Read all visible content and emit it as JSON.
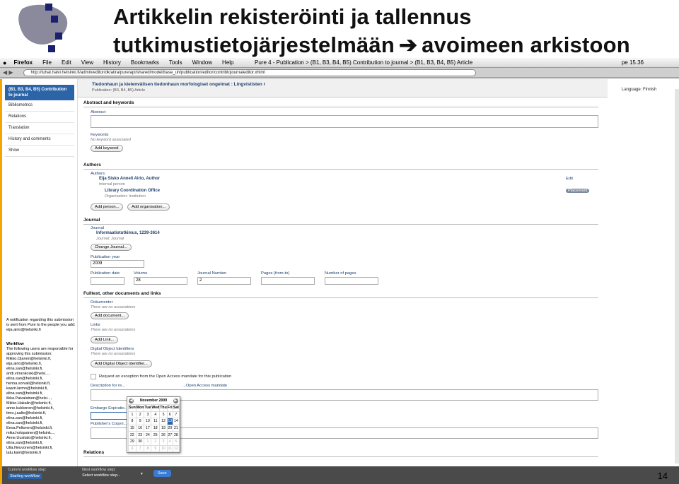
{
  "slide": {
    "title_line1": "Artikkelin rekisteröinti ja tallennus",
    "title_line2a": "tutkimustietojärjestelmään",
    "arrow": "➔",
    "title_line2b": "avoimeen arkistoon",
    "page_number": "14"
  },
  "menubar": {
    "apple": "",
    "items": [
      "Firefox",
      "File",
      "Edit",
      "View",
      "History",
      "Bookmarks",
      "Tools",
      "Window",
      "Help"
    ],
    "window_title": "Pure 4 - Publication > (B1, B3, B4, B5) Contribution to journal > (B1, B3, B4, B5) Article",
    "clock": "pe 15.36"
  },
  "toolbar": {
    "url": "http://tuhat.halvi.helsinki.fi/admin/editor/dk/atira/pure/api/shared/model/base_uh/publication/editor/contribtojournaleditor.xhtml"
  },
  "header": {
    "title": "Tiedonhaun ja kielenvälisen tiedonhaun morfologiset ongelmat : Lingvististen r",
    "subtitle": "Publication: (B3, B4, B5) Article"
  },
  "language": {
    "label": "Language:",
    "value": "Finnish"
  },
  "sidebar": {
    "active": "(B1, B3, B4, B5) Contribution to journal",
    "items": [
      "Bibliometrics",
      "Relations",
      "Translation",
      "History and comments",
      "Show"
    ],
    "notification": "A notification regarding this submission is sent from Pure to the people you add: eija.airio@helsinki.fi",
    "workflow_title": "Workflow",
    "workflow_text": "The following users are responsible for approving this submission: Mikko.Ojanen@helsinki.fi, eija.airio@helsinki.fi, elina.san@helsinki.fi, antti.virrankoski@helsi..., elina.san@helsinki.fi, henna.sorvali@helsinki.fi, kaarri.larmo@helsinki.fi, elina.san@helsinki.fi, ilkka.Paivalainen@helsi..., Mikko.Hakalin@helsinki.fi, anne.kukkonen@helsinki.fi, timo.j.aalto@helsinki.fi, elina.san@helsinki.fi, elina.san@helsinki.fi, Eeva.Peltonen@helsinki.fi, mika.holopainen@helsink..., Anne.Uusitalo@helsinki.fi, elina.san@helsinki.fi, Ulla.Neuvonen@helsinki.fi, tatu.kairi@helsinki.fi"
  },
  "sections": {
    "abstract": "Abstract and keywords",
    "abstract_label": "Abstract",
    "keywords_label": "Keywords",
    "no_keyword": "No keyword associated",
    "add_keyword": "Add keyword",
    "authors": "Authors",
    "authors_label": "Authors",
    "author_name": "Eija Sisko Anneli Airio, Author",
    "author_type": "Internal person",
    "org_name": "Library Coordination Office",
    "org_type": "Organisation: Institution",
    "edit": "Edit",
    "placement": "Placement",
    "add_person": "Add person...",
    "add_org": "Add organisation...",
    "journal": "Journal",
    "journal_label": "Journal",
    "journal_name": "Informaatiotutkimus, 1239-3614",
    "journal_type": "Journal: Journal",
    "change_journal": "Change Journal...",
    "pubyear_label": "Publication year",
    "pubyear": "2009",
    "pubdate_label": "Publication date",
    "volume_label": "Volume",
    "volume": "28",
    "journalnum_label": "Journal Number",
    "journalnum": "2",
    "pages_label": "Pages (from-to)",
    "numpages_label": "Number of pages",
    "fulltext": "Fulltext, other documents and links",
    "documents_label": "Dokumenter",
    "no_assoc": "There are no associations",
    "add_document": "Add document...",
    "links_label": "Links",
    "add_link": "Add Link...",
    "doi_label": "Digital Object Identifiers",
    "add_doi": "Add Digital Object Identifier...",
    "oa_request": "Request an exception from the Open Access mandate for this publication",
    "desc_label": "Description for re...",
    "desc_suffix": "...Open Access mandate",
    "embargo_label": "Embargo Expiratio...",
    "copyright_label": "Publisher's Copyri...",
    "relations": "Relations"
  },
  "calendar": {
    "month": "November 2009",
    "days": [
      "Sun",
      "Mon",
      "Tue",
      "Wed",
      "Thu",
      "Fri",
      "Sat"
    ],
    "weeks": [
      [
        "1",
        "2",
        "3",
        "4",
        "5",
        "6",
        "7"
      ],
      [
        "8",
        "9",
        "10",
        "11",
        "12",
        "13",
        "14"
      ],
      [
        "15",
        "16",
        "17",
        "18",
        "19",
        "20",
        "21"
      ],
      [
        "22",
        "23",
        "24",
        "25",
        "26",
        "27",
        "28"
      ],
      [
        "29",
        "30",
        "1",
        "2",
        "3",
        "4",
        "5"
      ],
      [
        "6",
        "7",
        "8",
        "9",
        "10",
        "11",
        "12"
      ]
    ],
    "selected": "13"
  },
  "footer": {
    "current_label": "Current workflow step:",
    "current": "Starting workflow",
    "next_label": "Next workflow step:",
    "next": "Select workflow step...",
    "save": "Save"
  }
}
